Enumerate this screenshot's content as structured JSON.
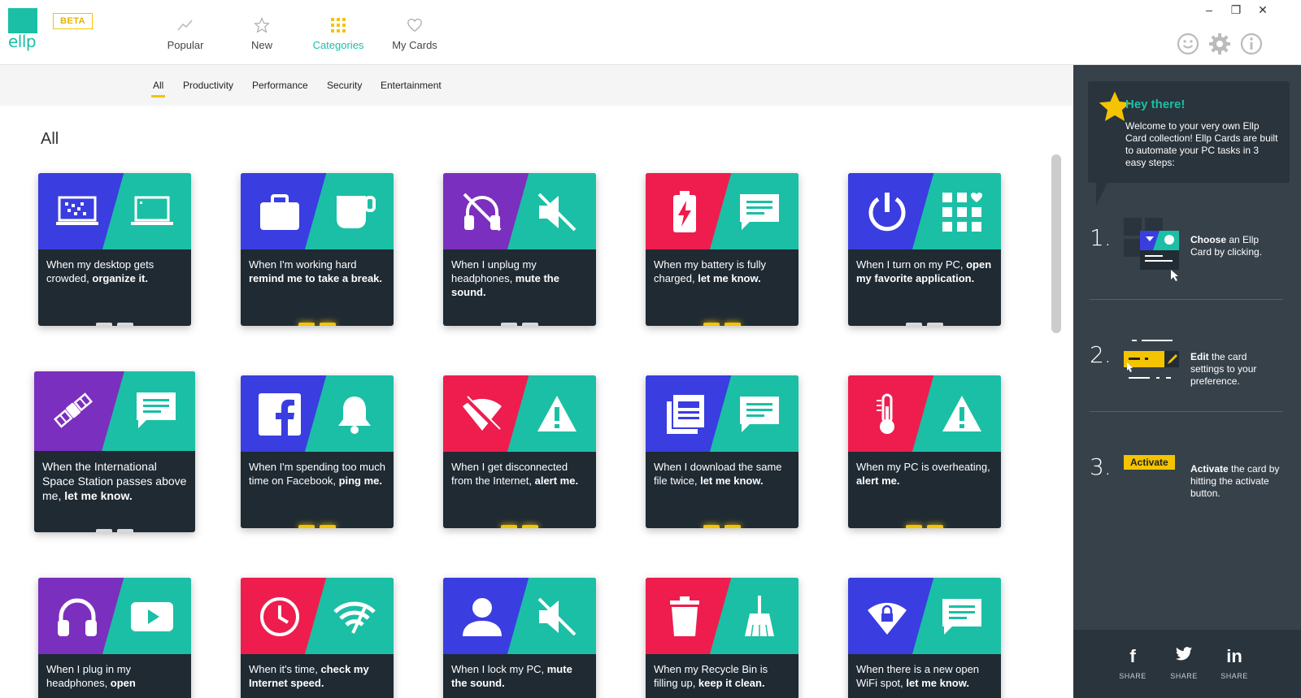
{
  "app": {
    "logo": "ellp",
    "beta": "BETA"
  },
  "nav": {
    "tabs": [
      {
        "label": "Popular",
        "icon": "trend-icon"
      },
      {
        "label": "New",
        "icon": "star-icon"
      },
      {
        "label": "Categories",
        "icon": "grid-icon"
      },
      {
        "label": "My Cards",
        "icon": "heart-icon"
      }
    ],
    "active_tab": "Categories"
  },
  "subnav": {
    "tabs": [
      "All",
      "Productivity",
      "Performance",
      "Security",
      "Entertainment"
    ],
    "active": "All"
  },
  "section_title": "All",
  "colors": {
    "teal": "#1bbfa5",
    "yellow": "#f4c400",
    "purple": "#7b2fbe",
    "blue": "#3a3de0",
    "red": "#ee1d4e",
    "dark": "#1f2a33",
    "panel": "#37414a"
  },
  "cards": [
    {
      "pre": "When my desktop gets crowded, ",
      "bold": "organize it.",
      "left": "#3a3de0",
      "lico": "desktop-mess-icon",
      "rico": "laptop-icon",
      "dots": "grey"
    },
    {
      "pre": "When I'm working hard ",
      "bold": "remind me to take a break.",
      "left": "#3a3de0",
      "lico": "briefcase-icon",
      "rico": "coffee-cup-icon",
      "dots": "gold"
    },
    {
      "pre": "When I unplug my headphones, ",
      "bold": "mute the sound.",
      "left": "#7b2fbe",
      "lico": "headphones-off-icon",
      "rico": "mute-icon",
      "dots": "grey"
    },
    {
      "pre": "When my battery is fully charged, ",
      "bold": "let me know.",
      "left": "#ee1d4e",
      "lico": "battery-charging-icon",
      "rico": "message-icon",
      "dots": "gold"
    },
    {
      "pre": "When I turn on my PC, ",
      "bold": "open my favorite application.",
      "left": "#3a3de0",
      "lico": "power-icon",
      "rico": "apps-heart-icon",
      "dots": "grey"
    },
    {
      "pre": "When the International Space Station passes above me, ",
      "bold": "let me know.",
      "left": "#7b2fbe",
      "lico": "satellite-icon",
      "rico": "message-icon",
      "dots": "grey",
      "big": true
    },
    {
      "pre": "When I'm spending too much time on Facebook, ",
      "bold": "ping me.",
      "left": "#3a3de0",
      "lico": "facebook-icon",
      "rico": "bell-icon",
      "dots": "gold"
    },
    {
      "pre": "When I get disconnected from the Internet, ",
      "bold": "alert me.",
      "left": "#ee1d4e",
      "lico": "wifi-off-icon",
      "rico": "warning-icon",
      "dots": "gold"
    },
    {
      "pre": "When I download the same file twice, ",
      "bold": "let me know.",
      "left": "#3a3de0",
      "lico": "documents-icon",
      "rico": "message-icon",
      "dots": "gold"
    },
    {
      "pre": "When my PC is overheating, ",
      "bold": "alert me.",
      "left": "#ee1d4e",
      "lico": "thermometer-icon",
      "rico": "warning-icon",
      "dots": "gold"
    },
    {
      "pre": "When I plug in my headphones, ",
      "bold": "open",
      "left": "#7b2fbe",
      "lico": "headphones-icon",
      "rico": "youtube-icon",
      "dots": "none"
    },
    {
      "pre": "When it's time, ",
      "bold": "check my Internet speed.",
      "left": "#ee1d4e",
      "lico": "clock-icon",
      "rico": "wifi-speed-icon",
      "dots": "none"
    },
    {
      "pre": "When I lock my PC, ",
      "bold": "mute the sound.",
      "left": "#3a3de0",
      "lico": "user-icon",
      "rico": "mute-icon",
      "dots": "none"
    },
    {
      "pre": "When my Recycle Bin is filling up, ",
      "bold": "keep it clean.",
      "left": "#ee1d4e",
      "lico": "trash-icon",
      "rico": "broom-icon",
      "dots": "none"
    },
    {
      "pre": "When there is a new open WiFi spot, ",
      "bold": "let me know.",
      "left": "#3a3de0",
      "lico": "wifi-lock-icon",
      "rico": "message-icon",
      "dots": "none"
    }
  ],
  "panel": {
    "hey": "Hey there!",
    "welcome": "Welcome to your very own Ellp Card collection! Ellp Cards are built to automate your PC tasks in 3 easy steps:",
    "steps": [
      {
        "num": "1.",
        "bold": "Choose",
        "rest": " an Ellp Card by clicking."
      },
      {
        "num": "2.",
        "bold": "Edit",
        "rest": " the card settings to your preference."
      },
      {
        "num": "3.",
        "bold": "Activate",
        "rest": " the card by hitting the activate button."
      }
    ],
    "activate_label": "Activate",
    "share": [
      {
        "icon": "f",
        "label": "SHARE",
        "name": "facebook-share"
      },
      {
        "icon": "t",
        "label": "SHARE",
        "name": "twitter-share"
      },
      {
        "icon": "in",
        "label": "SHARE",
        "name": "linkedin-share"
      }
    ]
  }
}
